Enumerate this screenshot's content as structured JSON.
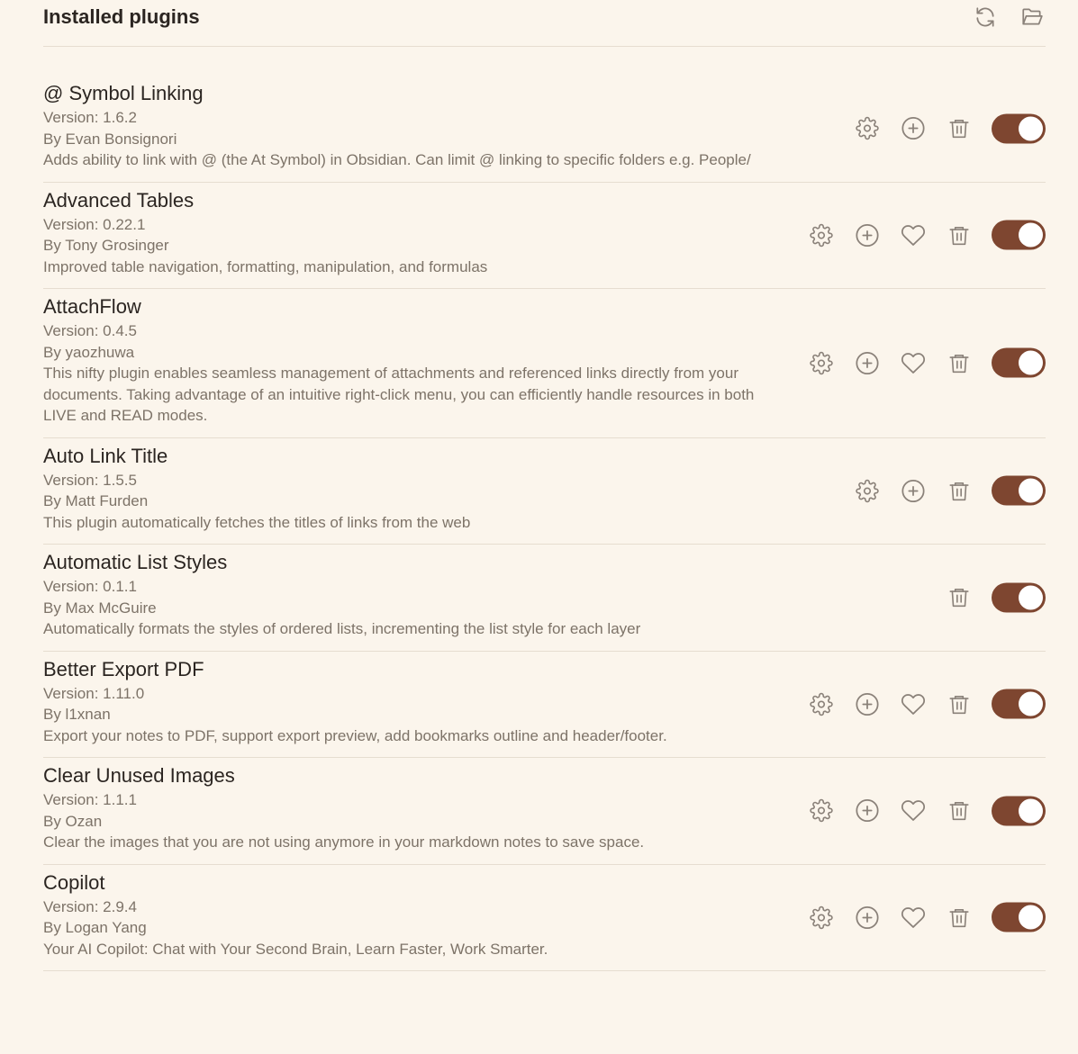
{
  "header": {
    "title": "Installed plugins",
    "reload_icon": "refresh-icon",
    "folder_icon": "open-folder-icon"
  },
  "colors": {
    "background": "#fbf5ec",
    "accent_toggle": "#7e4630",
    "icon": "#8a8179",
    "muted_text": "#7d7368"
  },
  "plugins": [
    {
      "name": "@ Symbol Linking",
      "version": "Version: 1.6.2",
      "author": "By Evan Bonsignori",
      "description": "Adds ability to link with @ (the At Symbol) in Obsidian. Can limit @ linking to specific folders e.g. People/",
      "actions": [
        "settings",
        "hotkeys",
        "uninstall"
      ],
      "enabled": true
    },
    {
      "name": "Advanced Tables",
      "version": "Version: 0.22.1",
      "author": "By Tony Grosinger",
      "description": "Improved table navigation, formatting, manipulation, and formulas",
      "actions": [
        "settings",
        "hotkeys",
        "donate",
        "uninstall"
      ],
      "enabled": true
    },
    {
      "name": "AttachFlow",
      "version": "Version: 0.4.5",
      "author": "By yaozhuwa",
      "description": "This nifty plugin enables seamless management of attachments and referenced links directly from your documents. Taking advantage of an intuitive right-click menu, you can efficiently handle resources in both LIVE and READ modes.",
      "actions": [
        "settings",
        "hotkeys",
        "donate",
        "uninstall"
      ],
      "enabled": true
    },
    {
      "name": "Auto Link Title",
      "version": "Version: 1.5.5",
      "author": "By Matt Furden",
      "description": "This plugin automatically fetches the titles of links from the web",
      "actions": [
        "settings",
        "hotkeys",
        "uninstall"
      ],
      "enabled": true
    },
    {
      "name": "Automatic List Styles",
      "version": "Version: 0.1.1",
      "author": "By Max McGuire",
      "description": "Automatically formats the styles of ordered lists, incrementing the list style for each layer",
      "actions": [
        "uninstall"
      ],
      "enabled": true
    },
    {
      "name": "Better Export PDF",
      "version": "Version: 1.11.0",
      "author": "By l1xnan",
      "description": "Export your notes to PDF, support export preview, add bookmarks outline and header/footer.",
      "actions": [
        "settings",
        "hotkeys",
        "donate",
        "uninstall"
      ],
      "enabled": true
    },
    {
      "name": "Clear Unused Images",
      "version": "Version: 1.1.1",
      "author": "By Ozan",
      "description": "Clear the images that you are not using anymore in your markdown notes to save space.",
      "actions": [
        "settings",
        "hotkeys",
        "donate",
        "uninstall"
      ],
      "enabled": true
    },
    {
      "name": "Copilot",
      "version": "Version: 2.9.4",
      "author": "By Logan Yang",
      "description": "Your AI Copilot: Chat with Your Second Brain, Learn Faster, Work Smarter.",
      "actions": [
        "settings",
        "hotkeys",
        "donate",
        "uninstall"
      ],
      "enabled": true
    }
  ]
}
